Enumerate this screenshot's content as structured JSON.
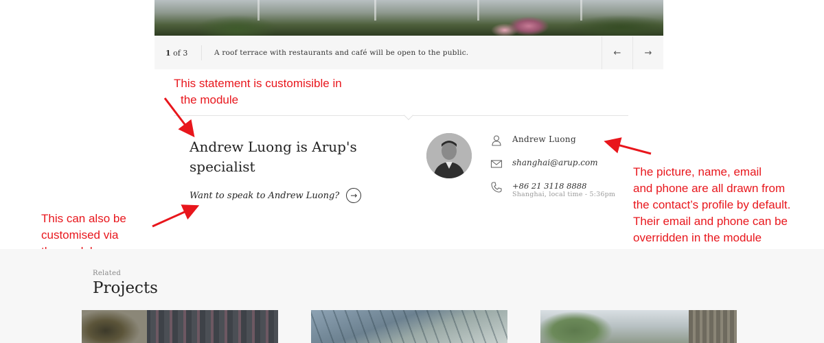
{
  "carousel": {
    "counter_current": "1",
    "counter_of": "of 3",
    "caption": "A roof terrace with restaurants and café will be open to the public.",
    "prev_icon": "←",
    "next_icon": "→"
  },
  "contact_module": {
    "statement": "Andrew Luong is Arup's specialist",
    "cta_text": "Want to speak to Andrew Luong?",
    "cta_icon": "→",
    "name": "Andrew Luong",
    "email": "shanghai@arup.com",
    "phone": "+86 21 3118 8888",
    "location_time": "Shanghai, local time - 5:36pm"
  },
  "annotations": {
    "statement_note_line1": "This statement is customisible in",
    "statement_note_line2": "the module",
    "cta_note_line1": "This can also be",
    "cta_note_line2": "customised via",
    "cta_note_line3": "the module",
    "profile_note_line1": "The picture, name, email",
    "profile_note_line2": "and phone are all drawn from",
    "profile_note_line3": "the contact’s profile by default.",
    "profile_note_line4": "Their email and phone can be",
    "profile_note_line5": "overridden in the module"
  },
  "related": {
    "kicker": "Related",
    "title": "Projects"
  },
  "colors": {
    "annotation": "#e8161c",
    "caption_bar": "#f6f6f6",
    "related_bg": "#f7f7f7"
  }
}
